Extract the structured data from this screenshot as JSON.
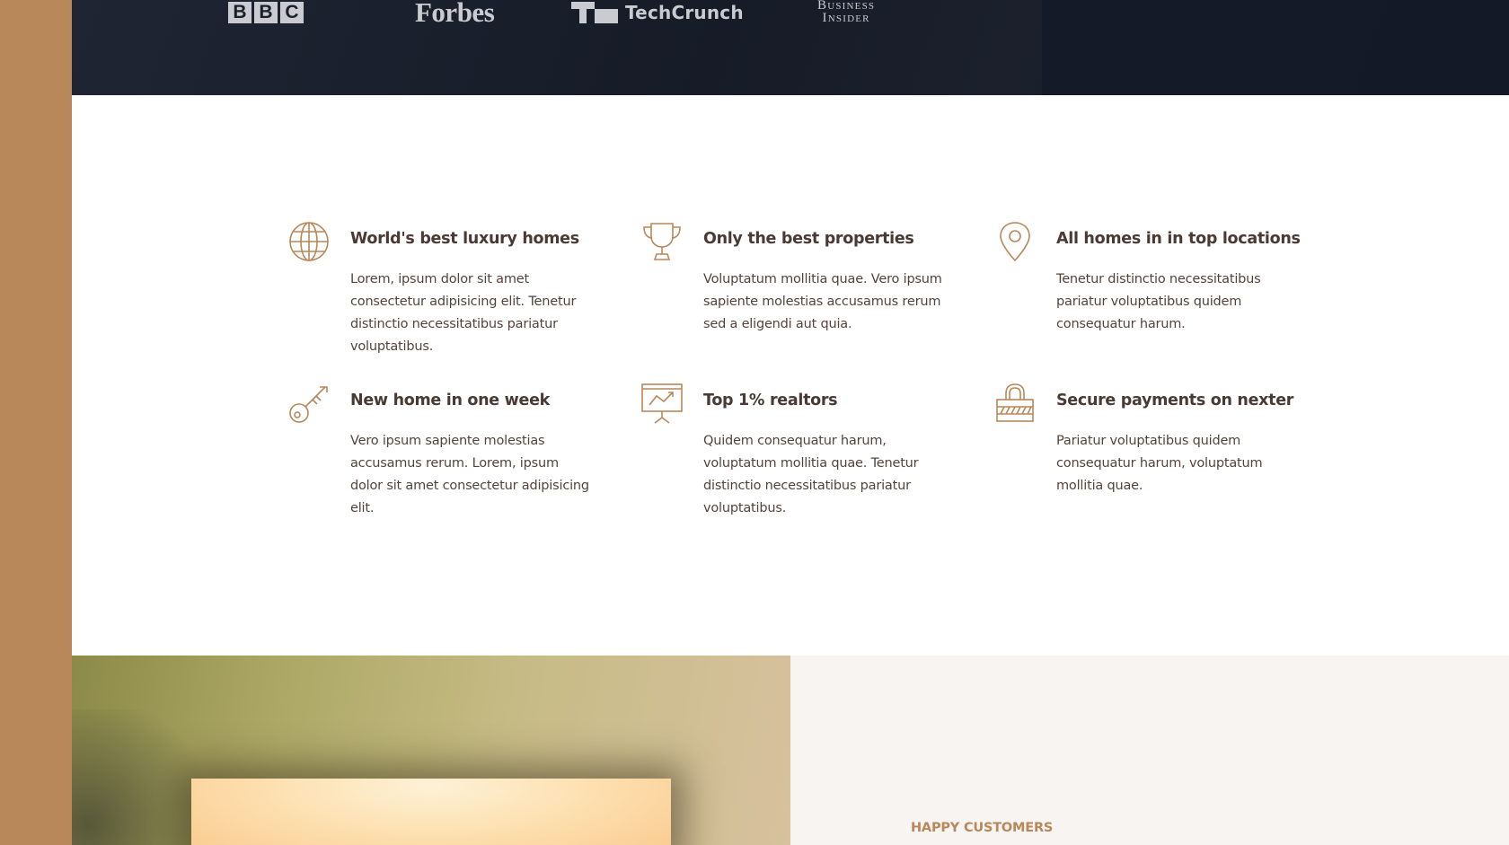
{
  "press": {
    "logos": [
      {
        "name": "BBC",
        "letters": [
          "B",
          "B",
          "C"
        ]
      },
      {
        "name": "Forbes"
      },
      {
        "name": "TechCrunch"
      },
      {
        "name": "Business Insider",
        "lines": [
          "Business",
          "Insider"
        ]
      }
    ]
  },
  "features": [
    {
      "icon": "globe-icon",
      "title": "World's best luxury homes",
      "text": "Lorem, ipsum dolor sit amet consectetur adipisicing elit. Tenetur distinctio necessitatibus pariatur voluptatibus."
    },
    {
      "icon": "trophy-icon",
      "title": "Only the best properties",
      "text": "Voluptatum mollitia quae. Vero ipsum sapiente molestias accusamus rerum sed a eligendi aut quia."
    },
    {
      "icon": "map-pin-icon",
      "title": "All homes in in top locations",
      "text": "Tenetur distinctio necessitatibus pariatur voluptatibus quidem consequatur harum."
    },
    {
      "icon": "key-icon",
      "title": "New home in one week",
      "text": "Vero ipsum sapiente molestias accusamus rerum. Lorem, ipsum dolor sit amet consectetur adipisicing elit."
    },
    {
      "icon": "presentation-chart-icon",
      "title": "Top 1% realtors",
      "text": "Quidem consequatur harum, voluptatum mollitia quae. Tenetur distinctio necessitatibus pariatur voluptatibus."
    },
    {
      "icon": "padlock-icon",
      "title": "Secure payments on nexter",
      "text": "Pariatur voluptatibus quidem consequatur harum, voluptatum mollitia quae."
    }
  ],
  "testimonials": {
    "eyebrow": "HAPPY CUSTOMERS"
  },
  "colors": {
    "accent": "#b8875a",
    "dark_band": "#161b27",
    "heading": "#4a3a33",
    "body_text": "#55433b",
    "light_bg": "#f8f4f2"
  }
}
